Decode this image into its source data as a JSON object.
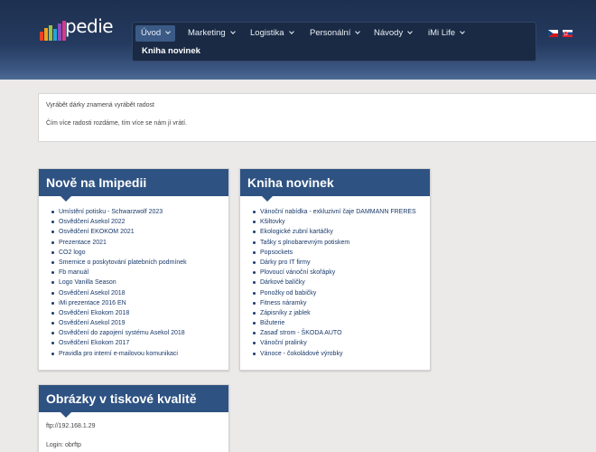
{
  "header": {
    "logo_text": "pedie",
    "nav": [
      {
        "label": "Úvod",
        "active": true
      },
      {
        "label": "Marketing",
        "active": false
      },
      {
        "label": "Logistika",
        "active": false
      },
      {
        "label": "Personální",
        "active": false
      },
      {
        "label": "Návody",
        "active": false
      },
      {
        "label": "iMi Life",
        "active": false
      }
    ],
    "subnav_item": "Kniha novinek",
    "languages": [
      {
        "code": "cs",
        "icon": "czech-flag-icon"
      },
      {
        "code": "sk",
        "icon": "slovak-flag-icon"
      }
    ]
  },
  "banner": {
    "line1": "Vyrábět dárky znamená vyrábět radost",
    "line2": "Čím více radosti rozdáme, tím více se nám jí vrátí."
  },
  "panels": {
    "new": {
      "title": "Nově na Imipedii",
      "items": [
        "Umístění potisku - Schwarzwolf 2023",
        "Osvědčení Asekol 2022",
        "Osvědčení EKOKOM 2021",
        "Prezentace 2021",
        "CO2 logo",
        "Smernice o poskytování platebních podmínek",
        "Fb manuál",
        "Logo Vanilla Season",
        "Osvědčení Asekol 2018",
        "iMi prezentace 2016 EN",
        "Osvědčení Ekokom 2018",
        "Osvědčení Asekol 2019",
        "Osvědčení do zapojení systému Asekol 2018",
        "Osvědčení Ekokom 2017",
        "Pravidla pro interní e-mailovou komunikaci"
      ]
    },
    "news": {
      "title": "Kniha novinek",
      "items": [
        "Vánoční nabídka - exkluzivní čaje DAMMANN FRERES",
        "Kšiltovky",
        "Ekologické zubní kartáčky",
        "Tašky s plnobarevným potiskem",
        "Popsockets",
        "Dárky pro IT firmy",
        "Plovoucí vánoční skořápky",
        "Dárkové balíčky",
        "Ponožky od babičky",
        "Fitness náramky",
        "Zápisníky z jablek",
        "Bižuterie",
        "Zasaď strom - ŠKODA AUTO",
        "Vánoční pralinky",
        "Vánoce - čokoládové výrobky"
      ]
    },
    "images": {
      "title": "Obrázky v tiskové kvalitě",
      "ftp": "ftp://192.168.1.29",
      "login": "Login: obrftp"
    }
  },
  "colors": {
    "header_bg": "#243a5f",
    "nav_bg": "#1a2a44",
    "nav_active": "#3b5a86",
    "panel_head": "#2e5282",
    "page_bg": "#ebeae8",
    "link": "#1a3a6a"
  }
}
